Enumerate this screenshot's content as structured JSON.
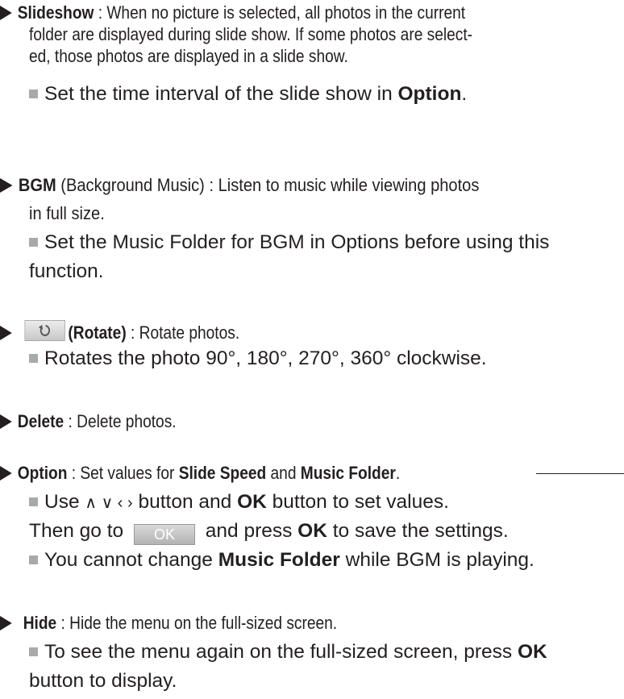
{
  "slideshow": {
    "title": "Slideshow",
    "desc1": " : When no picture is selected, all photos in the current",
    "desc2": "folder are displayed during slide show. If some photos are select-",
    "desc3": "ed, those photos are displayed in a slide show.",
    "note_prefix": "Set the time interval of the slide show in ",
    "note_bold": "Option",
    "note_suffix": "."
  },
  "bgm": {
    "title": "BGM",
    "desc1": " (Background Music) : Listen to music while viewing photos",
    "desc2": "in full size.",
    "note1": "Set the Music Folder for BGM in Options before using this",
    "note2": "function."
  },
  "rotate": {
    "title": "(Rotate)",
    "desc": " : Rotate photos.",
    "note": "Rotates the photo 90°, 180°, 270°, 360° clockwise.",
    "icon": "rotate-icon"
  },
  "delete": {
    "title": "Delete",
    "desc": " : Delete photos."
  },
  "option": {
    "title": "Option",
    "desc_prefix": " : Set values for ",
    "slide_speed": "Slide Speed",
    "and": " and ",
    "music_folder": "Music Folder",
    "period": ".",
    "note1_prefix": "Use ",
    "nav_glyphs": "∧ ∨ ‹ ›",
    "note1_mid": " button and ",
    "ok": "OK",
    "note1_suffix": " button to set values.",
    "note2_prefix": "Then go to ",
    "ok_button_label": "OK",
    "note2_mid": " and press ",
    "note2_suffix": " to save the settings.",
    "note3_prefix": "You cannot change ",
    "note3_bold": "Music Folder",
    "note3_suffix": " while BGM is playing."
  },
  "hide": {
    "title": "Hide",
    "desc": " : Hide the menu on the full-sized screen.",
    "note1_prefix": "To see the menu again on the full-sized screen, press ",
    "note1_bold": "OK",
    "note2": "button to display."
  }
}
